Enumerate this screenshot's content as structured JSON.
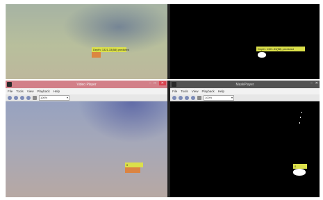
{
  "windows": {
    "video_player": {
      "title": "Video Player",
      "menu": [
        "File",
        "Tools",
        "View",
        "Playback",
        "Help"
      ],
      "zoom": "100%"
    },
    "mask_player": {
      "title": "MaskPlayer",
      "menu": [
        "File",
        "Tools",
        "View",
        "Playback",
        "Help"
      ],
      "zoom": "100%"
    }
  },
  "overlays": {
    "top_video_label": "Depth: 1321.33(58) predicted",
    "top_mask_label": "Depth: 1321.33(58) predicted",
    "bottom_video_label": "0",
    "bottom_mask_label": "0"
  },
  "window_controls": {
    "minimize": "–",
    "maximize": "□",
    "close": "✕"
  },
  "colors": {
    "video_titlebar": "#d27f88",
    "mask_titlebar": "#525252",
    "label_fill": "#dbe04a",
    "box_fill": "#e07f36",
    "mask_background": "#000000"
  }
}
